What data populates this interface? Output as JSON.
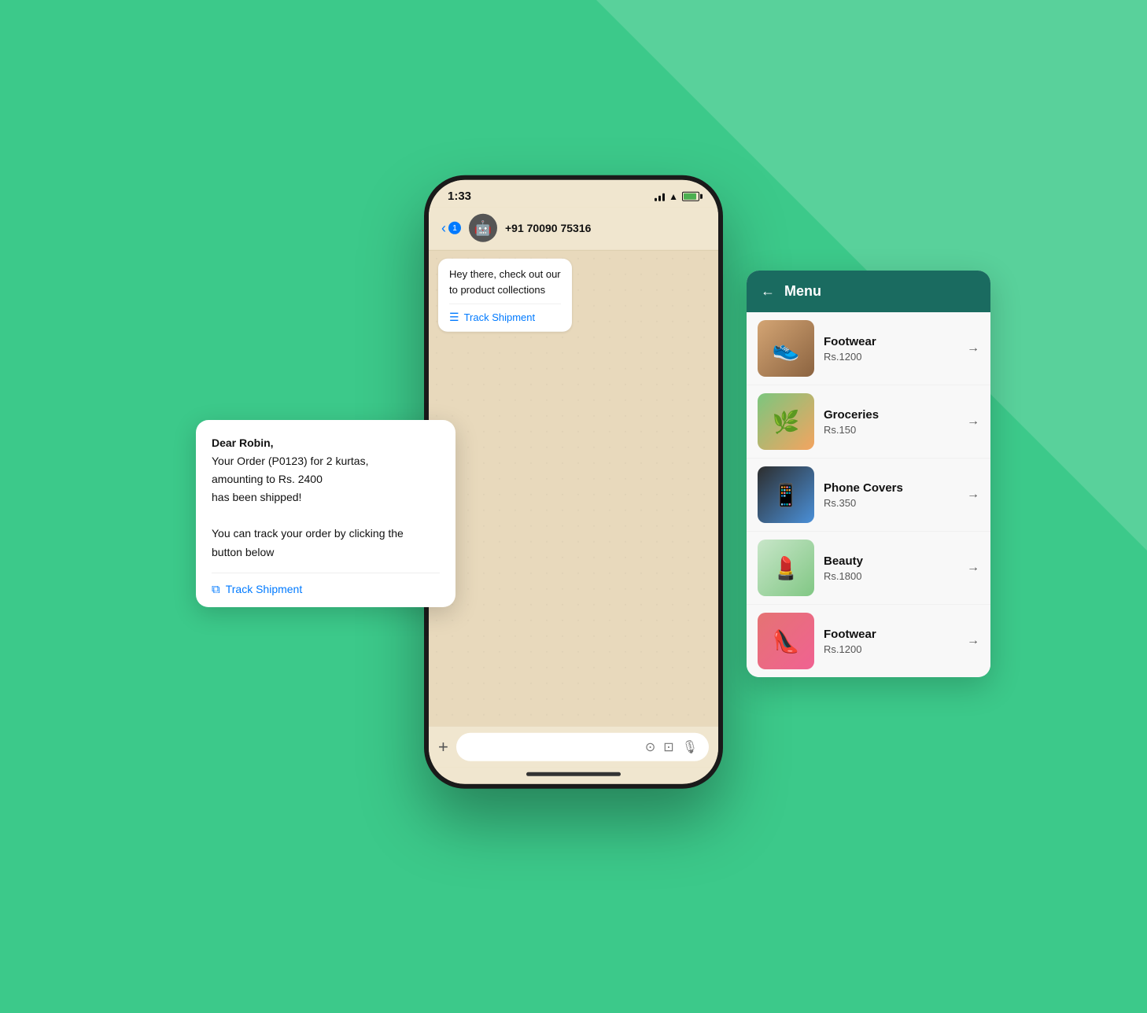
{
  "background": {
    "color": "#3cc98a"
  },
  "status_bar": {
    "time": "1:33",
    "signal": "signal",
    "wifi": "wifi",
    "battery": "battery"
  },
  "header": {
    "back_label": "1",
    "contact_avatar": "🤖",
    "contact_name": "+91 70090 75316"
  },
  "chat": {
    "bubble1": {
      "text": "Hey there, check out our\nto product collections",
      "action_label": "Track Shipment",
      "action_icon": "list"
    }
  },
  "floating_card": {
    "text_line1": "Dear Robin,",
    "text_line2": "Your Order (P0123) for 2 kurtas,",
    "text_line3": "amounting to Rs. 2400",
    "text_line4": "has been shipped!",
    "text_line5": "",
    "text_line6": "You can track your order by clicking the",
    "text_line7": "button below",
    "action_label": "Track Shipment",
    "action_icon": "external-link"
  },
  "menu": {
    "back_icon": "←",
    "title": "Menu",
    "items": [
      {
        "name": "Footwear",
        "price": "Rs.1200",
        "thumb_type": "footwear",
        "emoji": "👟"
      },
      {
        "name": "Groceries",
        "price": "Rs.150",
        "thumb_type": "groceries",
        "emoji": "🌿"
      },
      {
        "name": "Phone Covers",
        "price": "Rs.350",
        "thumb_type": "phone",
        "emoji": "📱"
      },
      {
        "name": "Beauty",
        "price": "Rs.1800",
        "thumb_type": "beauty",
        "emoji": "💄"
      },
      {
        "name": "Footwear",
        "price": "Rs.1200",
        "thumb_type": "footwear2",
        "emoji": "👠"
      }
    ]
  },
  "input_bar": {
    "plus_icon": "+",
    "icon1": "sticker",
    "icon2": "camera",
    "icon3": "mic"
  }
}
